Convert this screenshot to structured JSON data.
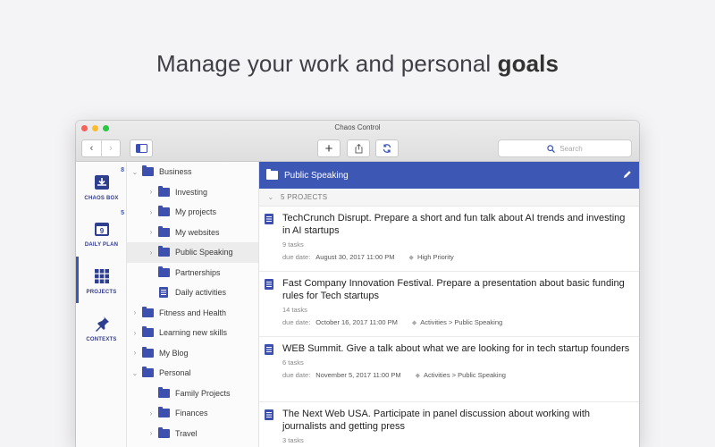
{
  "headline": {
    "prefix": "Manage your work and personal",
    "bold": "goals"
  },
  "window": {
    "title": "Chaos Control"
  },
  "toolbar": {
    "back": "‹",
    "forward": "›",
    "add": "+",
    "search_placeholder": "Search"
  },
  "iconbar": {
    "items": [
      {
        "label": "CHAOS BOX",
        "badge": "8",
        "icon": "inbox-icon"
      },
      {
        "label": "DAILY PLAN",
        "badge": "5",
        "icon": "calendar-icon"
      },
      {
        "label": "PROJECTS",
        "badge": "",
        "icon": "grid-icon"
      },
      {
        "label": "CONTEXTS",
        "badge": "",
        "icon": "pin-icon"
      }
    ],
    "selected": "PROJECTS"
  },
  "tree": {
    "rows": [
      {
        "label": "Business",
        "level": 0,
        "expanded": true,
        "type": "folder"
      },
      {
        "label": "Investing",
        "level": 1,
        "expanded": false,
        "type": "folder"
      },
      {
        "label": "My projects",
        "level": 1,
        "expanded": false,
        "type": "folder"
      },
      {
        "label": "My websites",
        "level": 1,
        "expanded": false,
        "type": "folder"
      },
      {
        "label": "Public Speaking",
        "level": 1,
        "expanded": false,
        "type": "folder",
        "selected": true
      },
      {
        "label": "Partnerships",
        "level": 1,
        "expanded": null,
        "type": "folder"
      },
      {
        "label": "Daily activities",
        "level": 1,
        "expanded": null,
        "type": "doc"
      },
      {
        "label": "Fitness and Health",
        "level": 0,
        "expanded": false,
        "type": "folder"
      },
      {
        "label": "Learning new skills",
        "level": 0,
        "expanded": false,
        "type": "folder"
      },
      {
        "label": "My Blog",
        "level": 0,
        "expanded": false,
        "type": "folder"
      },
      {
        "label": "Personal",
        "level": 0,
        "expanded": true,
        "type": "folder"
      },
      {
        "label": "Family Projects",
        "level": 1,
        "expanded": null,
        "type": "folder"
      },
      {
        "label": "Finances",
        "level": 1,
        "expanded": false,
        "type": "folder"
      },
      {
        "label": "Travel",
        "level": 1,
        "expanded": false,
        "type": "folder"
      }
    ]
  },
  "main": {
    "header": "Public Speaking",
    "section": "5 PROJECTS",
    "projects": [
      {
        "title": "TechCrunch Disrupt. Prepare a short and fun talk about AI trends and investing in AI startups",
        "tasks": "9 tasks",
        "due_label": "due date:",
        "due": "August 30, 2017 11:00 PM",
        "tag": "High Priority"
      },
      {
        "title": "Fast Company Innovation Festival. Prepare a presentation about basic funding rules for Tech startups",
        "tasks": "14 tasks",
        "due_label": "due date:",
        "due": "October 16, 2017 11:00 PM",
        "tag": "Activities > Public Speaking"
      },
      {
        "title": "WEB Summit. Give a talk about what we are looking for in tech startup founders",
        "tasks": "6 tasks",
        "due_label": "due date:",
        "due": "November 5, 2017 11:00 PM",
        "tag": "Activities > Public Speaking"
      },
      {
        "title": "The Next Web USA. Participate in panel discussion about working with journalists and getting press",
        "tasks": "3 tasks",
        "due_label": "",
        "due": "",
        "tag": ""
      }
    ]
  },
  "colors": {
    "accent": "#3d57b5",
    "folder": "#3d50b0"
  }
}
